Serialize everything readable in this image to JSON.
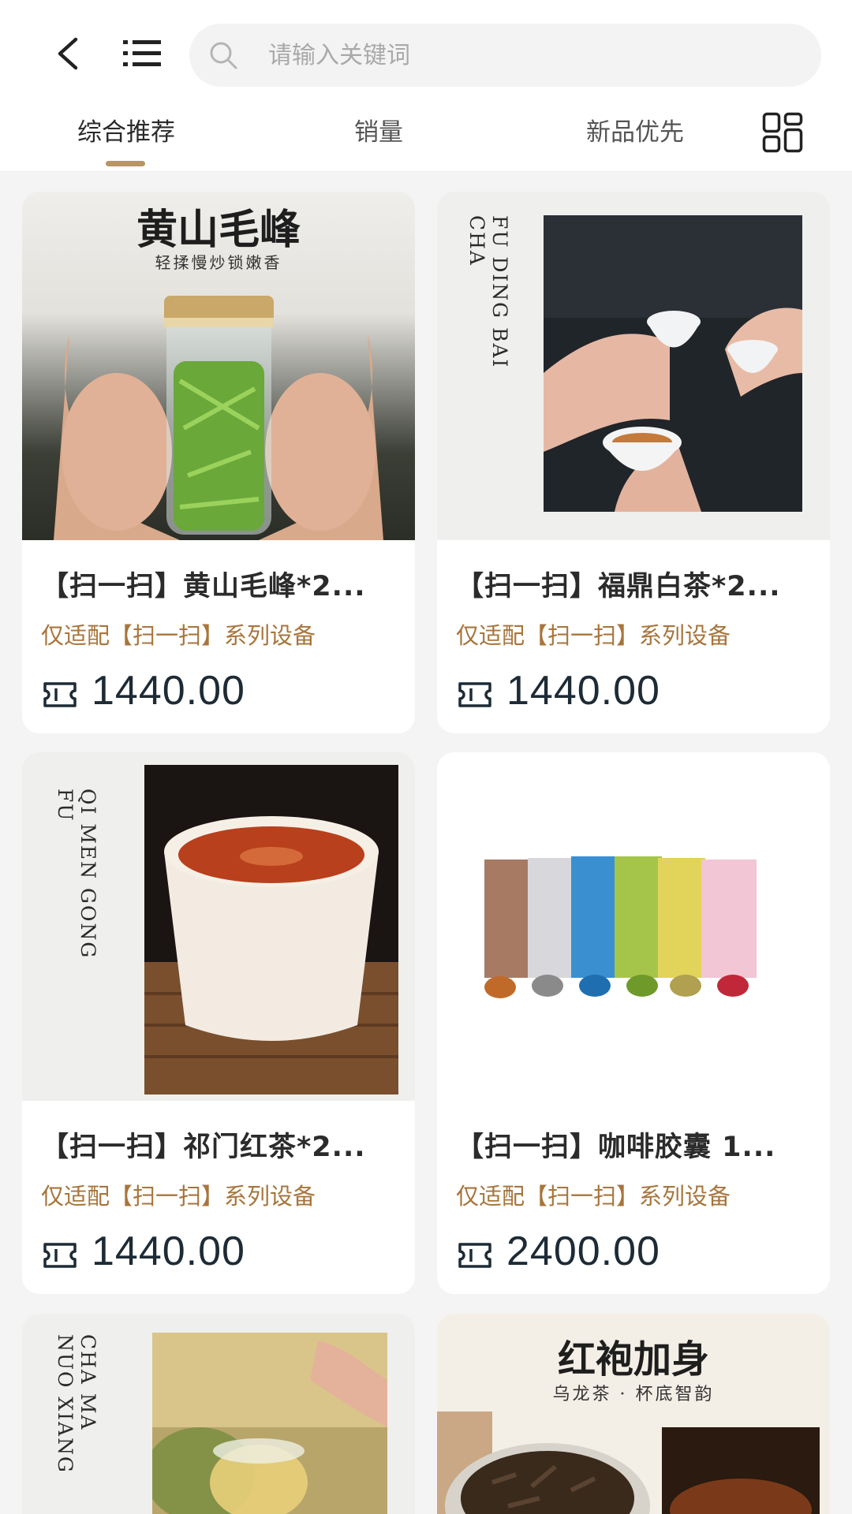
{
  "header": {
    "back_icon": "chevron-left-icon",
    "menu_icon": "list-icon",
    "search": {
      "placeholder": "请输入关键词",
      "value": "",
      "icon": "search-icon"
    }
  },
  "sort_tabs": [
    {
      "label": "综合推荐",
      "active": true
    },
    {
      "label": "销量",
      "active": false
    },
    {
      "label": "新品优先",
      "active": false
    }
  ],
  "layout_toggle_icon": "grid-view-icon",
  "colors": {
    "accent": "#b79565",
    "subtitle": "#a7753c",
    "price": "#1d2b36",
    "background": "#f4f4f4"
  },
  "products": [
    {
      "title": "【扫一扫】黄山毛峰*2...",
      "subtitle": "仅适配【扫一扫】系列设备",
      "price": "1440.00",
      "price_icon": "ticket-icon",
      "image": {
        "headline": "黄山毛峰",
        "subline": "轻揉慢炒锁嫩香",
        "depicts": "tea-jar-photo"
      }
    },
    {
      "title": "【扫一扫】福鼎白茶*2...",
      "subtitle": "仅适配【扫一扫】系列设备",
      "price": "1440.00",
      "price_icon": "ticket-icon",
      "image": {
        "vertical_text": "FU DING BAI CHA",
        "depicts": "tea-cups-photo"
      }
    },
    {
      "title": "【扫一扫】祁门红茶*2...",
      "subtitle": "仅适配【扫一扫】系列设备",
      "price": "1440.00",
      "price_icon": "ticket-icon",
      "image": {
        "vertical_text": "QI MEN GONG FU",
        "depicts": "black-tea-cup-photo"
      }
    },
    {
      "title": "【扫一扫】咖啡胶囊 1...",
      "subtitle": "仅适配【扫一扫】系列设备",
      "price": "2400.00",
      "price_icon": "ticket-icon",
      "image": {
        "depicts": "coffee-capsule-boxes-photo"
      }
    },
    {
      "image": {
        "vertical_text": "CHA MA NUO XIANG",
        "depicts": "tea-pouring-photo"
      }
    },
    {
      "image": {
        "headline": "红袍加身",
        "subline": "乌龙茶 · 杯底智韵",
        "depicts": "oolong-tea-photo"
      }
    }
  ]
}
